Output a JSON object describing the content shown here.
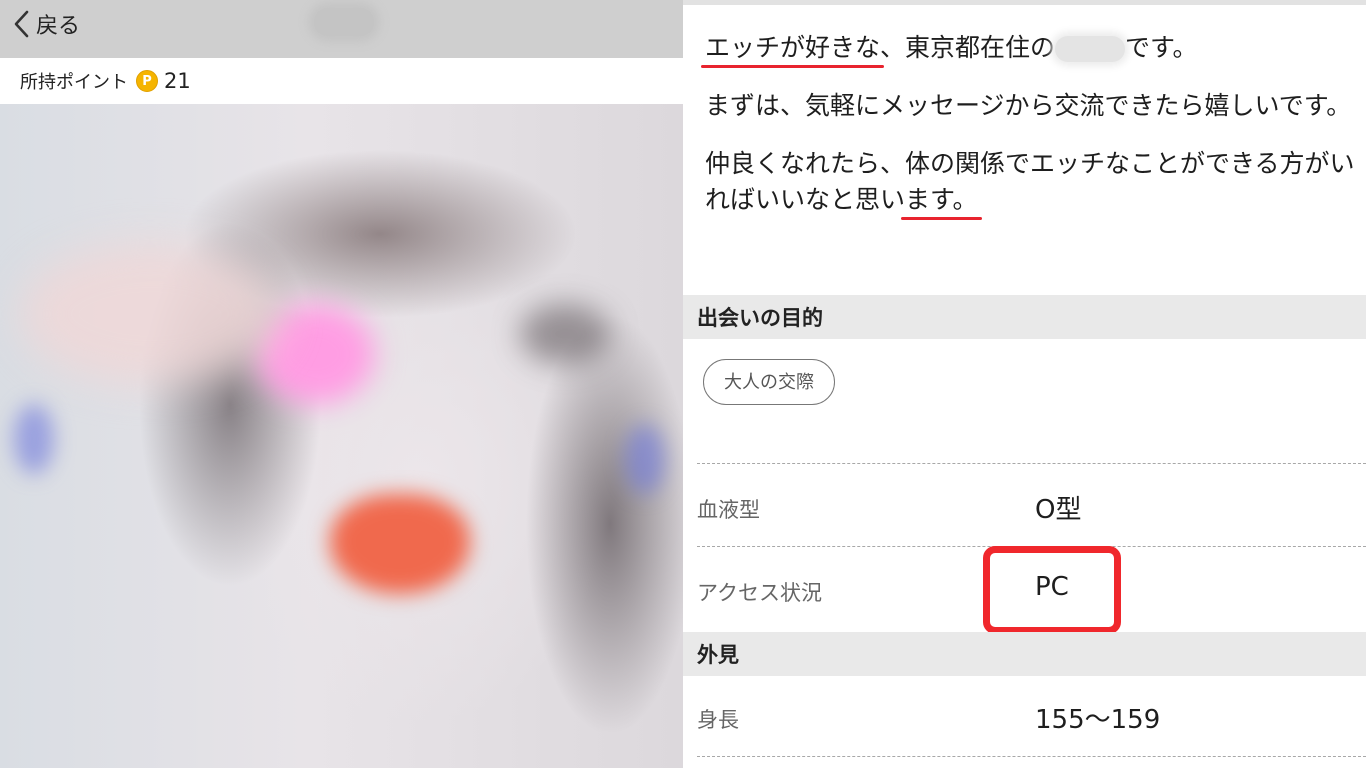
{
  "header": {
    "back_label": "戻る"
  },
  "points": {
    "label": "所持ポイント",
    "icon_letter": "P",
    "value": "21"
  },
  "profile": {
    "intro": {
      "line1_highlight": "エッチが好きな",
      "line1_rest": "、東京都在住の",
      "line1_end": "です。",
      "paragraph2": "まずは、気軽にメッセージから交流できたら嬉しいです。",
      "paragraph3_start": "仲良くなれたら、",
      "paragraph3_highlight": "体の関係でエッチなことができる方がいればいいなと思います。"
    },
    "purpose_section": {
      "heading": "出会いの目的",
      "tag": "大人の交際"
    },
    "details": [
      {
        "label": "血液型",
        "value": "O型"
      },
      {
        "label": "アクセス状況",
        "value": "PC"
      }
    ],
    "appearance_section": {
      "heading": "外見",
      "rows": [
        {
          "label": "身長",
          "value": "155〜159"
        }
      ]
    }
  },
  "colors": {
    "underline_red": "#e8232e",
    "box_red": "#f0272c",
    "point_coin": "#f5b400",
    "section_bg": "#e9e9e9",
    "topbar_bg": "#cfcfcf"
  }
}
